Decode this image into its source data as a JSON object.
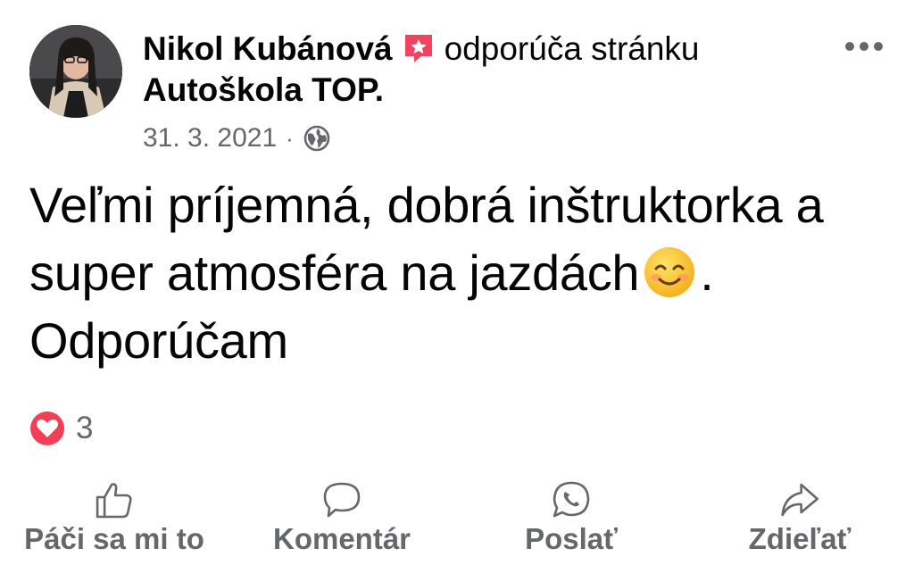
{
  "post": {
    "author": "Nikol Kubánová",
    "recommend_text": "odporúča stránku",
    "page_name": "Autoškola TOP",
    "page_suffix": ".",
    "date": "31. 3. 2021",
    "separator": "·",
    "body_part1": "Veľmi príjemná, dobrá inštruktorka a super atmosféra na jazdách",
    "body_part2": ". Odporúčam",
    "emoji_icon": "smiling-face-icon",
    "reaction_icon": "heart-icon",
    "reaction_count": "3"
  },
  "actions": [
    {
      "label": "Páči sa mi to",
      "icon": "like-icon"
    },
    {
      "label": "Komentár",
      "icon": "comment-icon"
    },
    {
      "label": "Poslať",
      "icon": "whatsapp-icon"
    },
    {
      "label": "Zdieľať",
      "icon": "share-icon"
    }
  ],
  "colors": {
    "text": "#050505",
    "secondary": "#65676b",
    "heart": "#f33e58",
    "badge": "#f3425f"
  }
}
